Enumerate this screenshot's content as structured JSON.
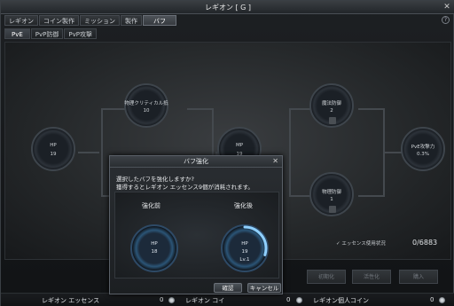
{
  "window": {
    "title": "レギオン [ G ]"
  },
  "tabs": [
    "レギオン",
    "コイン製作",
    "ミッション",
    "製作",
    "バフ"
  ],
  "subtabs": [
    "PvE",
    "PvP防御",
    "PvP攻撃"
  ],
  "nodes": {
    "hp": {
      "name": "HP",
      "level": "19"
    },
    "critical": {
      "name": "物理クリティカル抵",
      "level": "10"
    },
    "mp": {
      "name": "MP",
      "level": "19"
    },
    "magic_def": {
      "name": "魔法防御",
      "level": "2"
    },
    "phys_def": {
      "name": "物理防御",
      "level": "1"
    },
    "pve_atk": {
      "name": "PvE攻撃力",
      "level": "0.3%"
    }
  },
  "status": {
    "essence_label": "エッセンス使用状況",
    "essence_count": "0/6883"
  },
  "buttons": {
    "reset": "初期化",
    "activate": "活性化",
    "purchase": "購入"
  },
  "footer": {
    "essence_label": "レギオン エッセンス",
    "essence_value": "0",
    "coin_label": "レギオン コイ",
    "coin_value": "0",
    "personal_label": "レギオン個人コイン",
    "personal_value": "0"
  },
  "dialog": {
    "title": "バフ強化",
    "line1": "選択したバフを強化しますか?",
    "line2": "獲得するとレギオン エッセンス9個が消耗されます。",
    "before_label": "強化前",
    "after_label": "強化後",
    "before": {
      "name": "HP",
      "level": "18"
    },
    "after": {
      "name": "HP",
      "level": "19",
      "lv": "Lv.1"
    },
    "confirm": "確認",
    "cancel": "キャンセル",
    "progress_fraction": 0.3
  }
}
